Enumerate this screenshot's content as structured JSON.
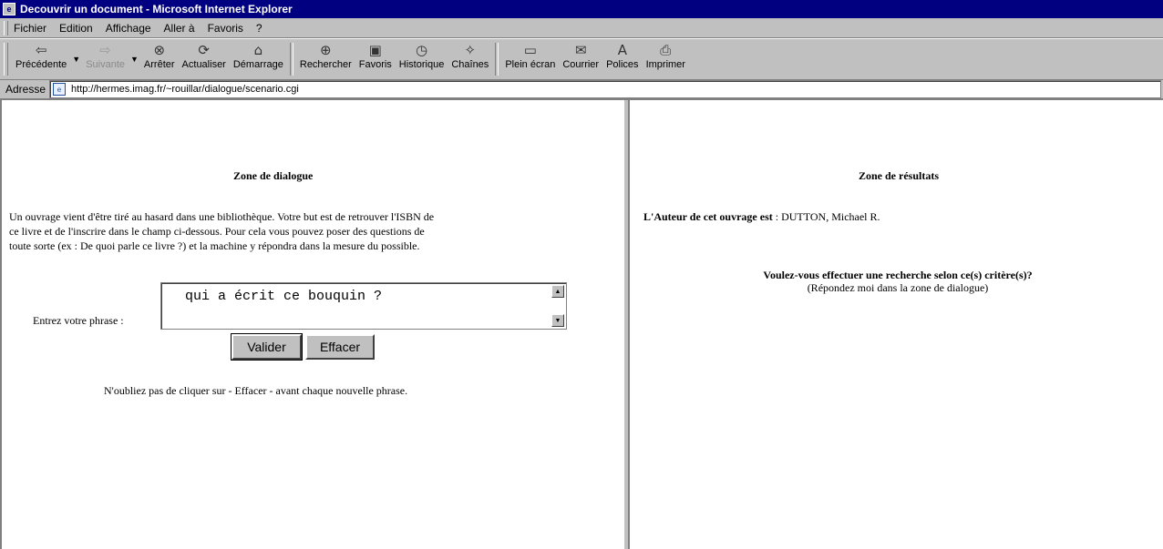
{
  "window": {
    "title": "Decouvrir un document - Microsoft Internet Explorer"
  },
  "menu": {
    "items": [
      "Fichier",
      "Edition",
      "Affichage",
      "Aller à",
      "Favoris",
      "?"
    ]
  },
  "toolbar": {
    "buttons": [
      {
        "label": "Précédente",
        "icon": "back-arrow-icon",
        "glyph": "⇦"
      },
      {
        "label": "Suivante",
        "icon": "forward-arrow-icon",
        "glyph": "⇨"
      },
      {
        "label": "Arrêter",
        "icon": "stop-icon",
        "glyph": "⊗"
      },
      {
        "label": "Actualiser",
        "icon": "refresh-icon",
        "glyph": "⟳"
      },
      {
        "label": "Démarrage",
        "icon": "home-icon",
        "glyph": "⌂"
      },
      {
        "label": "Rechercher",
        "icon": "search-icon",
        "glyph": "⊕"
      },
      {
        "label": "Favoris",
        "icon": "favorites-icon",
        "glyph": "▣"
      },
      {
        "label": "Historique",
        "icon": "history-icon",
        "glyph": "◷"
      },
      {
        "label": "Chaînes",
        "icon": "channels-icon",
        "glyph": "✧"
      },
      {
        "label": "Plein écran",
        "icon": "fullscreen-icon",
        "glyph": "▭"
      },
      {
        "label": "Courrier",
        "icon": "mail-icon",
        "glyph": "✉"
      },
      {
        "label": "Polices",
        "icon": "fonts-icon",
        "glyph": "A"
      },
      {
        "label": "Imprimer",
        "icon": "print-icon",
        "glyph": "⎙"
      }
    ]
  },
  "address": {
    "label": "Adresse",
    "url": "http://hermes.imag.fr/~rouillar/dialogue/scenario.cgi"
  },
  "left": {
    "title": "Zone de dialogue",
    "intro_1": "Un ouvrage vient d'être tiré au hasard dans une bibliothèque. Votre but est de retrouver l'ISBN de",
    "intro_2": "ce livre et de l'inscrire dans le champ ci-dessous. Pour cela vous pouvez poser des questions de",
    "intro_3": "toute sorte (ex : De quoi parle ce livre ?) et la machine y répondra dans la mesure du possible.",
    "input_label": "Entrez votre phrase :",
    "input_value": "qui a écrit ce bouquin ?",
    "submit_label": "Valider",
    "clear_label": "Effacer",
    "reminder": "N'oubliez pas de cliquer sur - Effacer - avant chaque nouvelle phrase."
  },
  "right": {
    "title": "Zone de résultats",
    "author_prefix": "L'Auteur de cet ouvrage est",
    "author_value": " : DUTTON, Michael R.",
    "question": "Voulez-vous effectuer une recherche selon ce(s) critère(s)?",
    "hint": "(Répondez moi dans la zone de dialogue)"
  }
}
